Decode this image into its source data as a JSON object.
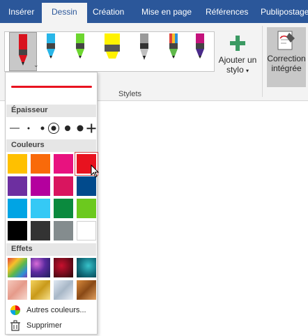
{
  "tabs": [
    {
      "label": "Insérer",
      "active": false
    },
    {
      "label": "Dessin",
      "active": true
    },
    {
      "label": "Création",
      "active": false
    },
    {
      "label": "Mise en page",
      "active": false
    },
    {
      "label": "Références",
      "active": false
    },
    {
      "label": "Publipostage",
      "active": false
    }
  ],
  "ribbon": {
    "pens": [
      {
        "name": "red-pen",
        "color": "#d9131e"
      },
      {
        "name": "cyan-pen",
        "color": "#29b6e8"
      },
      {
        "name": "green-pen",
        "color": "#6dd62f"
      },
      {
        "name": "yellow-highlighter",
        "color": "#fff200"
      },
      {
        "name": "gray-pencil",
        "color": "#7f7f7f"
      },
      {
        "name": "rainbow-pen",
        "color": "#e0433a"
      },
      {
        "name": "galaxy-pen",
        "color": "#c4137c"
      }
    ],
    "add_pen_label": "Ajouter un stylo",
    "add_pen_caret": "▾",
    "ink_correction_label": "Correction intégrée",
    "group_label": "Stylets"
  },
  "menu": {
    "thickness_header": "Épaisseur",
    "colors_header": "Couleurs",
    "effects_header": "Effets",
    "preview_color": "#e8121f",
    "thickness_steps": [
      "line",
      "xs",
      "s",
      "m-selected",
      "l",
      "xl",
      "plus"
    ],
    "colors": [
      "#ffc000",
      "#f96a0a",
      "#e8127f",
      "#e8121f",
      "#6d2fa0",
      "#b4009e",
      "#d9155f",
      "#014a8c",
      "#00a4e4",
      "#35c9f5",
      "#0b8a3e",
      "#6cc91e",
      "#000000",
      "#333333",
      "#848c8e",
      "#ffffff"
    ],
    "selected_color_index": 3,
    "effects": [
      "rainbow",
      "galaxy",
      "lava",
      "ocean",
      "rose-gold",
      "gold",
      "silver",
      "bronze"
    ],
    "more_colors_label": "Autres couleurs...",
    "delete_label": "Supprimer"
  }
}
